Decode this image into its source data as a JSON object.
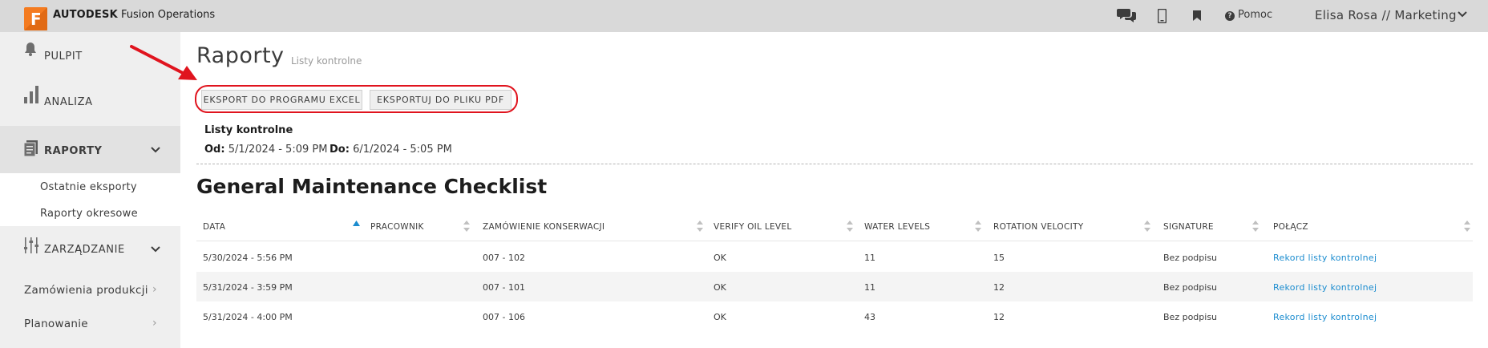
{
  "app": {
    "brand_bold": "AUTODESK",
    "brand_rest": "Fusion Operations",
    "logo_letter": "F",
    "help_label": "Pomoc",
    "user_label": "Elisa Rosa // Marketing"
  },
  "icons": {
    "top": [
      "chat-icon",
      "mobile-icon",
      "bookmark-icon",
      "help-icon",
      "chevron-down-icon"
    ],
    "sidebar": [
      "bell-icon",
      "bar-chart-icon",
      "report-icon",
      "sliders-icon"
    ]
  },
  "sidebar": {
    "pulpit": "PULPIT",
    "analiza": "ANALIZA",
    "raporty": "RAPORTY",
    "sub_items": [
      "Ostatnie eksporty",
      "Raporty okresowe"
    ],
    "zarzadzanie": "ZARZĄDZANIE",
    "links": [
      "Zamówienia produkcji",
      "Planowanie"
    ]
  },
  "page": {
    "title": "Raporty",
    "subtitle": "Listy kontrolne",
    "export_excel": "EKSPORT DO PROGRAMU EXCEL",
    "export_pdf": "EKSPORTUJ DO PLIKU PDF"
  },
  "filter": {
    "title": "Listy kontrolne",
    "from_label": "Od:",
    "from_value": "5/1/2024 - 5:09 PM",
    "to_label": "Do:",
    "to_value": "6/1/2024 - 5:05 PM"
  },
  "table": {
    "title": "General Maintenance Checklist",
    "columns": [
      "DATA",
      "PRACOWNIK",
      "ZAMÓWIENIE KONSERWACJI",
      "VERIFY OIL LEVEL",
      "WATER LEVELS",
      "ROTATION VELOCITY",
      "SIGNATURE",
      "POŁĄCZ"
    ],
    "sorted_column": "DATA",
    "rows": [
      [
        "5/30/2024 - 5:56 PM",
        "",
        "007 - 102",
        "OK",
        "11",
        "15",
        "Bez podpisu",
        "Rekord listy kontrolnej"
      ],
      [
        "5/31/2024 - 3:59 PM",
        "",
        "007 - 101",
        "OK",
        "11",
        "12",
        "Bez podpisu",
        "Rekord listy kontrolnej"
      ],
      [
        "5/31/2024 - 4:00 PM",
        "",
        "007 - 106",
        "OK",
        "43",
        "12",
        "Bez podpisu",
        "Rekord listy kontrolnej"
      ]
    ]
  },
  "colors": {
    "highlight": "#e0141e",
    "link": "#1b8ccf",
    "accent": "#f47b20"
  }
}
